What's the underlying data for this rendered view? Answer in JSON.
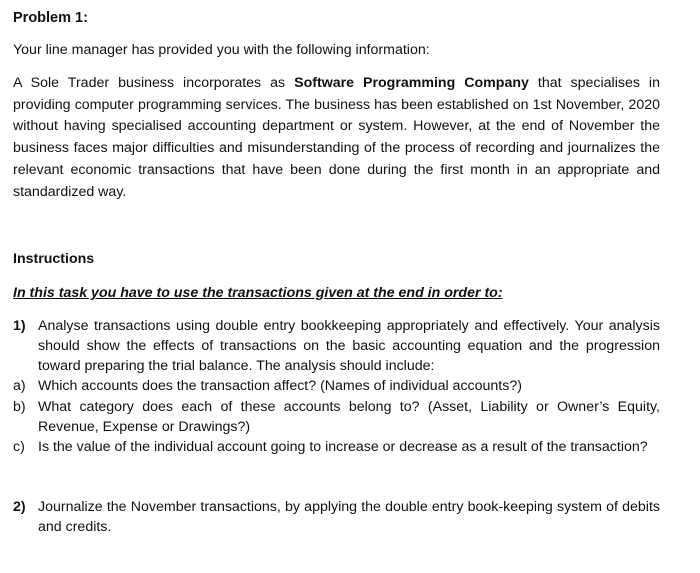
{
  "problem_title": "Problem 1:",
  "intro_line": "Your line manager has provided you with the following information:",
  "scenario": {
    "prefix": "A Sole Trader business incorporates as ",
    "company_name": "Software Programming Company",
    "suffix": " that specialises in providing computer programming services. The business has been established on 1st November, 2020 without having specialised accounting department or system. However, at the end of November the business faces major difficulties and misunderstanding of the process of recording and journalizes the relevant economic transactions that have been done during the first month in an appropriate and standardized way."
  },
  "instructions_heading": "Instructions",
  "task_subheading": "In this task you have to use the transactions given at the end in order to:",
  "items": [
    {
      "marker": "1)",
      "text": "Analyse transactions using double entry bookkeeping appropriately and effectively. Your analysis should show the effects of transactions on the basic accounting equation and the progression toward preparing the trial balance. The analysis should include:",
      "subitems": [
        {
          "marker": "a)",
          "text": "Which accounts does the transaction affect? (Names of individual accounts?)"
        },
        {
          "marker": "b)",
          "text": "What category does each of these accounts belong to? (Asset, Liability or Owner’s Equity, Revenue, Expense or Drawings?)"
        },
        {
          "marker": "c)",
          "text": "Is the value of the individual account going to increase or decrease as a result of the transaction?"
        }
      ]
    },
    {
      "marker": "2)",
      "text": "Journalize the November transactions, by applying the double entry book-keeping system of debits and credits."
    }
  ]
}
